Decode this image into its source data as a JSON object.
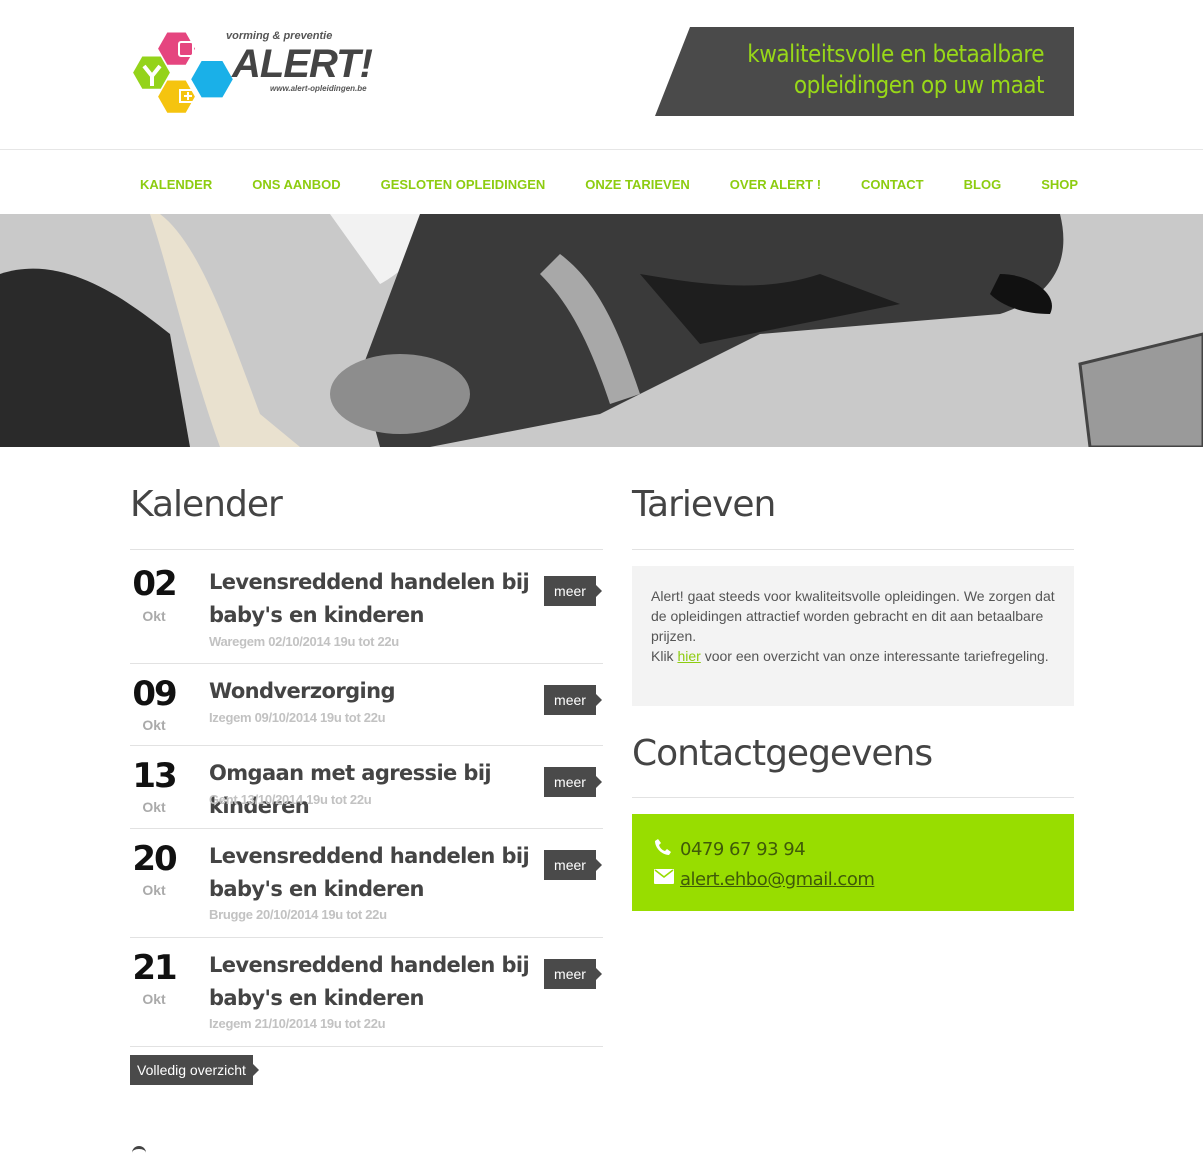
{
  "header": {
    "logo": {
      "tagline": "vorming & preventie",
      "wordmark": "ALERT!",
      "url": "www.alert-opleidingen.be"
    },
    "banner": {
      "line1": "kwaliteitsvolle en betaalbare",
      "line2": "opleidingen op uw maat"
    }
  },
  "nav": {
    "items": [
      {
        "label": "KALENDER"
      },
      {
        "label": "ONS AANBOD"
      },
      {
        "label": "GESLOTEN OPLEIDINGEN"
      },
      {
        "label": "ONZE TARIEVEN"
      },
      {
        "label": "OVER ALERT !"
      },
      {
        "label": "CONTACT"
      },
      {
        "label": "BLOG"
      },
      {
        "label": "SHOP"
      }
    ]
  },
  "kalender": {
    "title": "Kalender",
    "items": [
      {
        "day": "02",
        "month": "Okt",
        "title": "Levensreddend handelen bij baby's en kinderen",
        "sub": "Waregem 02/10/2014 19u tot 22u",
        "more": "meer"
      },
      {
        "day": "09",
        "month": "Okt",
        "title": "Wondverzorging",
        "sub": "Izegem 09/10/2014 19u tot 22u",
        "more": "meer"
      },
      {
        "day": "13",
        "month": "Okt",
        "title": "Omgaan met agressie bij kinderen",
        "sub": "Gent 13/10/2014 19u tot 22u",
        "more": "meer"
      },
      {
        "day": "20",
        "month": "Okt",
        "title": "Levensreddend handelen bij baby's en kinderen",
        "sub": "Brugge 20/10/2014 19u tot 22u",
        "more": "meer"
      },
      {
        "day": "21",
        "month": "Okt",
        "title": "Levensreddend handelen bij baby's en kinderen",
        "sub": "Izegem 21/10/2014 19u tot 22u",
        "more": "meer"
      }
    ],
    "overview_label": "Volledig overzicht"
  },
  "tarieven": {
    "title": "Tarieven",
    "text1": "Alert! gaat steeds voor kwaliteitsvolle opleidingen. We zorgen dat de opleidingen attractief worden gebracht en dit aan betaalbare prijzen.",
    "text2_prefix": "Klik ",
    "link": "hier",
    "text2_suffix": " voor een overzicht van onze interessante tariefregeling."
  },
  "contact": {
    "title": "Contactgegevens",
    "phone": "0479 67 93 94",
    "email": "alert.ehbo@gmail.com"
  },
  "colors": {
    "accent": "#8dcc10",
    "contact_bg": "#98dd00",
    "dark": "#4a4a4a"
  }
}
